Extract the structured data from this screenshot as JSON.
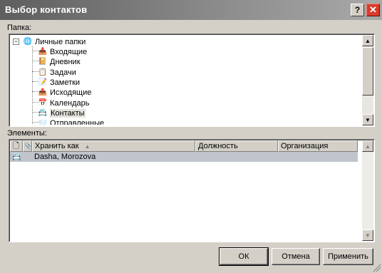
{
  "window": {
    "title": "Выбор контактов",
    "help_glyph": "?",
    "close_glyph": "✕"
  },
  "folders": {
    "label": "Папка:",
    "root": {
      "label": "Личные папки",
      "expander": "−",
      "icon": "🌐"
    },
    "items": [
      {
        "label": "Входящие",
        "icon": "📥"
      },
      {
        "label": "Дневник",
        "icon": "📔"
      },
      {
        "label": "Задачи",
        "icon": "📋"
      },
      {
        "label": "Заметки",
        "icon": "📝"
      },
      {
        "label": "Исходящие",
        "icon": "📤"
      },
      {
        "label": "Календарь",
        "icon": "📅"
      },
      {
        "label": "Контакты",
        "icon": "📇"
      },
      {
        "label": "Отправленные",
        "icon": "📨"
      }
    ]
  },
  "elements": {
    "label": "Элементы:",
    "columns": {
      "icon": "🗋",
      "attach": "📎",
      "file_as": "Хранить как",
      "position": "Должность",
      "company": "Организация"
    },
    "rows": [
      {
        "icon": "📇",
        "file_as": "Dasha, Morozova",
        "position": "",
        "company": ""
      }
    ]
  },
  "buttons": {
    "ok": "ОК",
    "cancel": "Отмена",
    "apply": "Применить"
  }
}
